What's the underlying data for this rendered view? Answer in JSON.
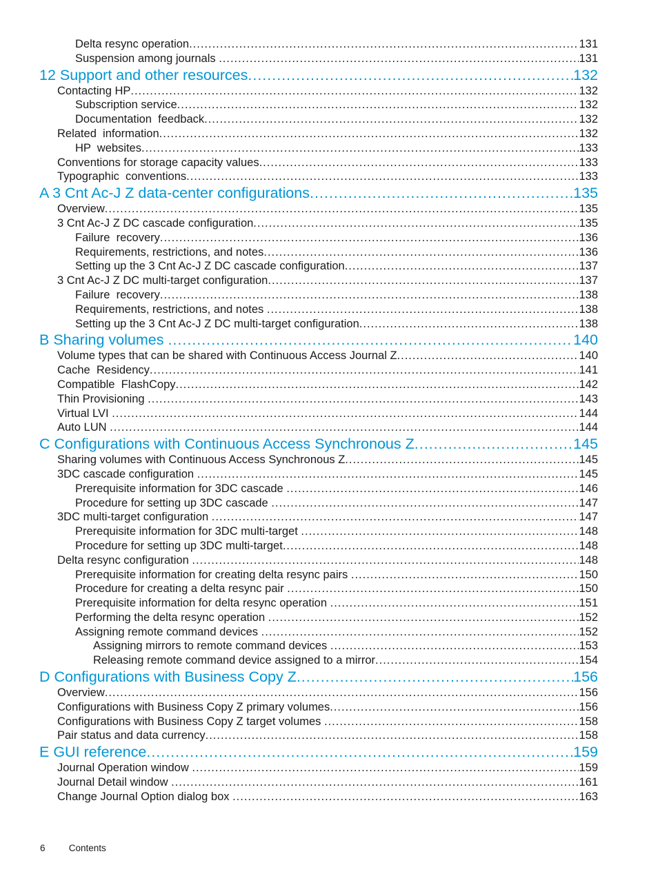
{
  "toc": [
    {
      "level": 2,
      "title": "Delta resync operation",
      "page": "131"
    },
    {
      "level": 2,
      "title": "Suspension among journals ",
      "page": "131"
    },
    {
      "level": 0,
      "title": "12 Support and other resources",
      "page": "132"
    },
    {
      "level": 1,
      "title": "Contacting HP",
      "page": "132"
    },
    {
      "level": 2,
      "title": "Subscription service",
      "page": "132"
    },
    {
      "level": 2,
      "title": "Documentation  feedback",
      "page": "132"
    },
    {
      "level": 1,
      "title": "Related  information",
      "page": "132"
    },
    {
      "level": 2,
      "title": "HP  websites",
      "page": "133"
    },
    {
      "level": 1,
      "title": "Conventions for storage capacity values",
      "page": "133"
    },
    {
      "level": 1,
      "title": "Typographic  conventions",
      "page": "133"
    },
    {
      "level": 0,
      "title": "A 3 Cnt Ac-J Z data-center configurations",
      "page": "135"
    },
    {
      "level": 1,
      "title": "Overview",
      "page": "135"
    },
    {
      "level": 1,
      "title": "3 Cnt Ac-J Z DC cascade configuration",
      "page": "135"
    },
    {
      "level": 2,
      "title": "Failure  recovery",
      "page": "136"
    },
    {
      "level": 2,
      "title": "Requirements, restrictions, and notes",
      "page": "136"
    },
    {
      "level": 2,
      "title": "Setting up the 3 Cnt Ac-J Z DC cascade configuration",
      "page": "137"
    },
    {
      "level": 1,
      "title": "3 Cnt Ac-J Z DC multi-target configuration",
      "page": "137"
    },
    {
      "level": 2,
      "title": "Failure  recovery",
      "page": "138"
    },
    {
      "level": 2,
      "title": "Requirements, restrictions, and notes ",
      "page": "138"
    },
    {
      "level": 2,
      "title": "Setting up the 3 Cnt Ac-J Z DC multi-target configuration",
      "page": "138"
    },
    {
      "level": 0,
      "title": "B Sharing volumes ",
      "page": "140"
    },
    {
      "level": 1,
      "title": "Volume types that can be shared with Continuous Access Journal Z",
      "page": "140"
    },
    {
      "level": 1,
      "title": "Cache  Residency",
      "page": "141"
    },
    {
      "level": 1,
      "title": "Compatible  FlashCopy",
      "page": "142"
    },
    {
      "level": 1,
      "title": "Thin Provisioning ",
      "page": "143"
    },
    {
      "level": 1,
      "title": "Virtual LVI ",
      "page": "144"
    },
    {
      "level": 1,
      "title": "Auto LUN ",
      "page": "144"
    },
    {
      "level": 0,
      "title": "C Configurations with Continuous Access Synchronous Z",
      "page": "145"
    },
    {
      "level": 1,
      "title": "Sharing volumes with Continuous Access Synchronous Z",
      "page": "145"
    },
    {
      "level": 1,
      "title": "3DC cascade configuration ",
      "page": "145"
    },
    {
      "level": 2,
      "title": "Prerequisite information for 3DC cascade ",
      "page": "146"
    },
    {
      "level": 2,
      "title": "Procedure for setting up 3DC cascade ",
      "page": "147"
    },
    {
      "level": 1,
      "title": "3DC multi-target configuration ",
      "page": "147"
    },
    {
      "level": 2,
      "title": "Prerequisite information for 3DC multi-target ",
      "page": "148"
    },
    {
      "level": 2,
      "title": "Procedure for setting up 3DC multi-target",
      "page": "148"
    },
    {
      "level": 1,
      "title": "Delta resync configuration ",
      "page": "148"
    },
    {
      "level": 2,
      "title": "Prerequisite information for creating delta resync pairs ",
      "page": "150"
    },
    {
      "level": 2,
      "title": "Procedure for creating a delta resync pair ",
      "page": "150"
    },
    {
      "level": 2,
      "title": "Prerequisite information for delta resync operation ",
      "page": "151"
    },
    {
      "level": 2,
      "title": "Performing the delta resync operation ",
      "page": "152"
    },
    {
      "level": 2,
      "title": "Assigning remote command devices ",
      "page": "152"
    },
    {
      "level": 3,
      "title": "Assigning mirrors to remote command devices ",
      "page": "153"
    },
    {
      "level": 3,
      "title": "Releasing remote command device assigned to a mirror",
      "page": "154"
    },
    {
      "level": 0,
      "title": "D Configurations with Business Copy Z",
      "page": "156"
    },
    {
      "level": 1,
      "title": "Overview",
      "page": "156"
    },
    {
      "level": 1,
      "title": "Configurations with Business Copy Z primary volumes",
      "page": "156"
    },
    {
      "level": 1,
      "title": "Configurations with Business Copy Z target volumes ",
      "page": "158"
    },
    {
      "level": 1,
      "title": "Pair status and data currency",
      "page": "158"
    },
    {
      "level": 0,
      "title": "E GUI reference",
      "page": "159"
    },
    {
      "level": 1,
      "title": "Journal Operation window ",
      "page": "159"
    },
    {
      "level": 1,
      "title": "Journal Detail window ",
      "page": "161"
    },
    {
      "level": 1,
      "title": "Change Journal Option dialog box ",
      "page": "163"
    }
  ],
  "footer": {
    "page_number": "6",
    "section": "Contents"
  },
  "colors": {
    "heading": "#0096d6",
    "text": "#1a1a1a"
  }
}
